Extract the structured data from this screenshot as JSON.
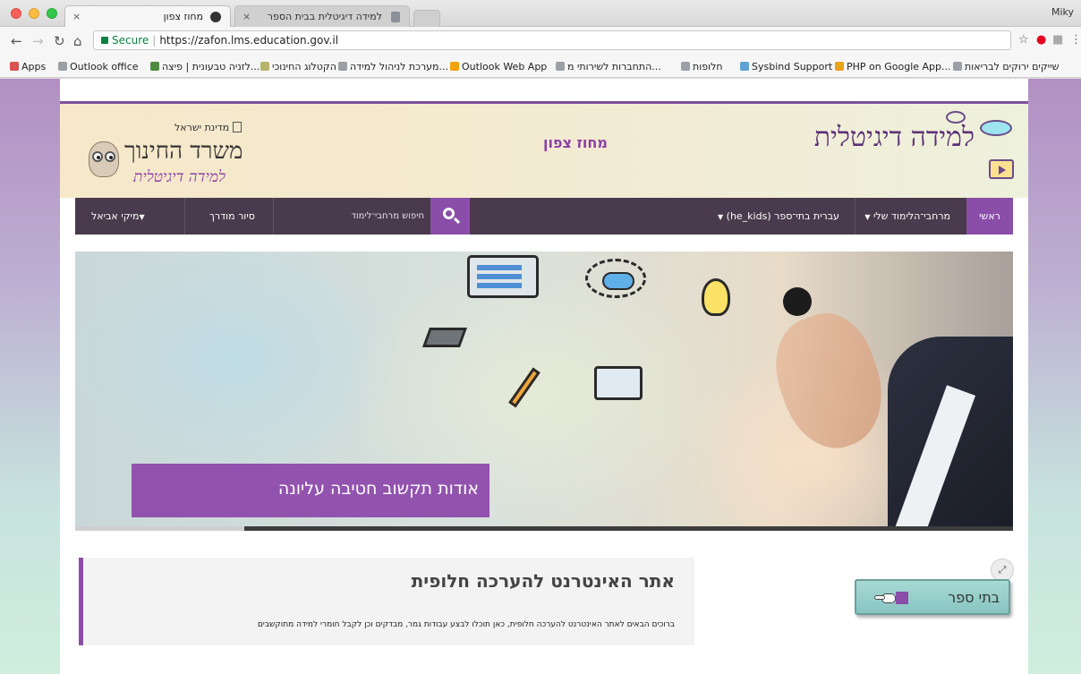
{
  "browser": {
    "tabs": [
      {
        "label": "מחוז צפון"
      },
      {
        "label": "למידה דיגיטלית בבית הספר"
      }
    ],
    "profile": "Miky",
    "secure_label": "Secure",
    "url": "https://zafon.lms.education.gov.il",
    "bookmarks": [
      "Apps",
      "Outlook office",
      "לזניה טבעונית | פיצה...",
      "הקטלוג החינוכי",
      "מערכת לניהול למידה...",
      "Outlook Web App",
      "התחברות לשירותי מ...",
      "חלופות",
      "Sysbind Support",
      "PHP on Google App...",
      "שייקים ירוקים לבריאות"
    ]
  },
  "header": {
    "logo_text": "למידה דיגיטלית",
    "district": "מחוז צפון",
    "ministry_state": "מדינת ישראל",
    "ministry_title": "משרד החינוך",
    "ministry_subtitle": "למידה דיגיטלית"
  },
  "nav": {
    "home": "ראשי",
    "my_spaces": "מרחבי־הלימוד שלי",
    "language": "עברית בתי־ספר (he_kids)",
    "search_placeholder": "חיפוש מרחבי־לימוד",
    "guided_tour": "סיור מודרך",
    "user": "מיקי אביאל"
  },
  "banner": {
    "caption": "אודות תקשוב חטיבה עליונה",
    "progress": 0.18
  },
  "welcome": {
    "title": "אתר האינטרנט להערכה חלופית",
    "text": "ברוכים הבאים לאתר האינטרנט להערכה חלופית, כאן תוכלו לבצע עבודות גמר, מבדקים וכן לקבל חומרי למידה מתוקשבים"
  },
  "schools_button": {
    "label": "בתי ספר"
  },
  "colors": {
    "brand_purple": "#8a4ea8",
    "nav_dark": "#4a3a4d",
    "teal_button": "#87c5c1"
  }
}
